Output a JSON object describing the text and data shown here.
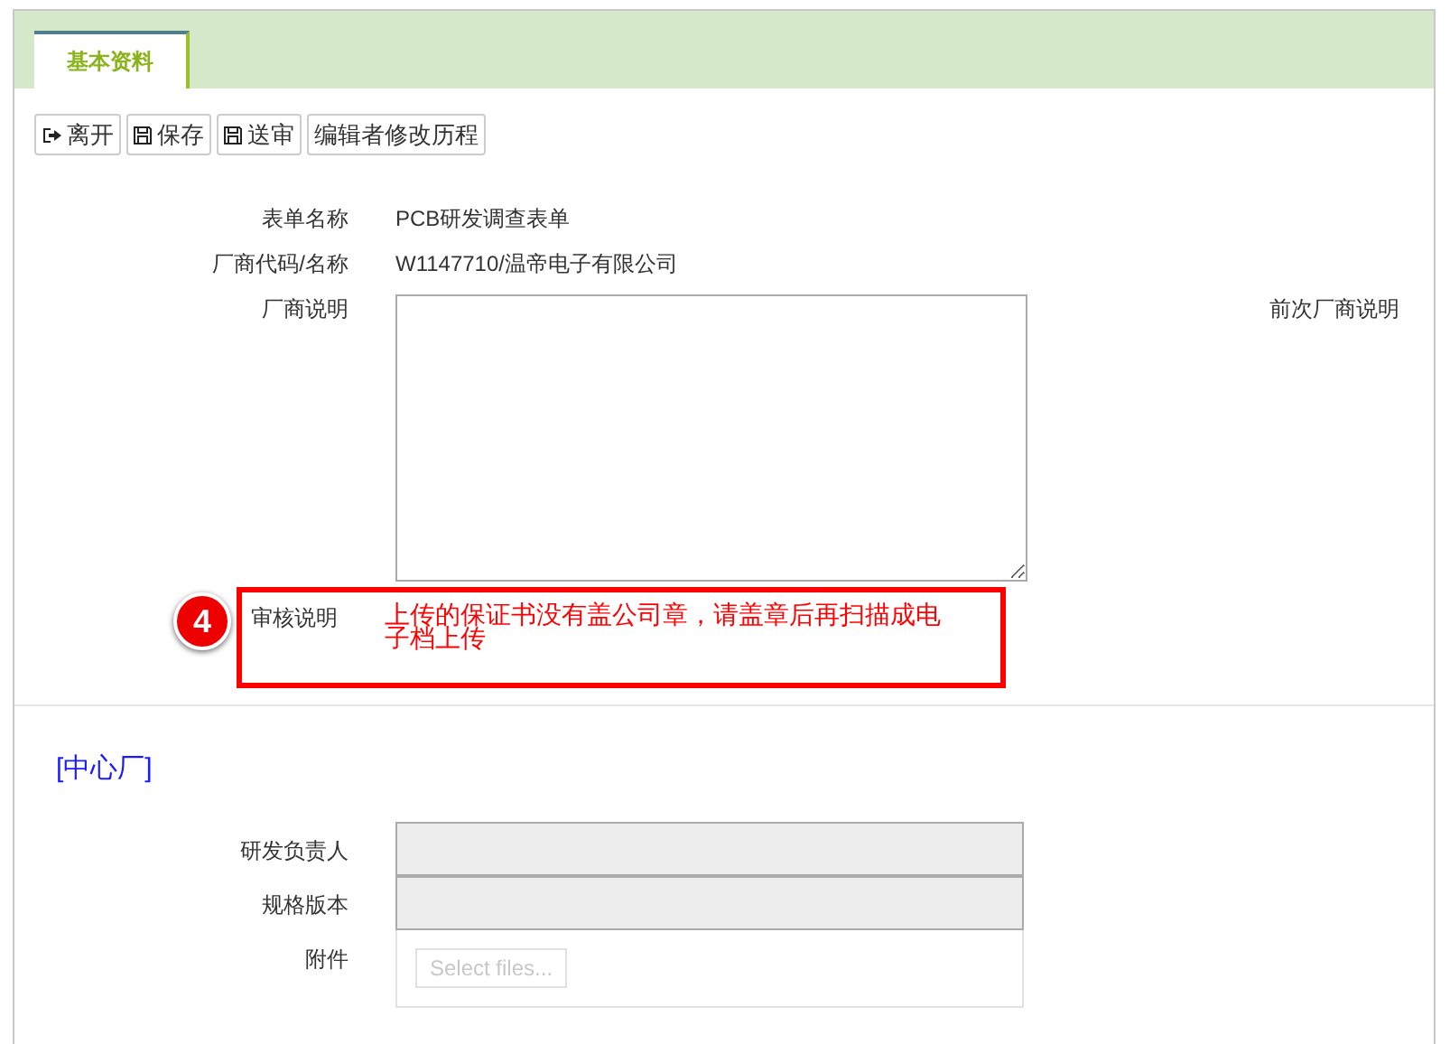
{
  "tabs": [
    {
      "label": "基本资料",
      "selected": true
    }
  ],
  "toolbar": [
    {
      "label": "离开",
      "kind": "exit"
    },
    {
      "label": "保存",
      "kind": "save"
    },
    {
      "label": "送审",
      "kind": "save"
    },
    {
      "label": "编辑者修改历程",
      "kind": "plain"
    }
  ],
  "form": {
    "form_name": {
      "label": "表单名称",
      "value": "PCB研发调查表单"
    },
    "vendor": {
      "label": "厂商代码/名称",
      "value": "W1147710/温帝电子有限公司"
    },
    "vendor_note": {
      "label": "厂商说明"
    },
    "previous_vendor_note": {
      "label": "前次厂商说明"
    },
    "review": {
      "badge": "4",
      "label": "审核说明",
      "value": "上传的保证书没有盖公司章，请盖章后再扫描成电子档上传"
    }
  },
  "section": {
    "title": "[中心厂]",
    "fields": [
      {
        "kind": "input",
        "label": "研发负责人",
        "disabled": true
      },
      {
        "kind": "input",
        "label": "规格版本",
        "disabled": true
      },
      {
        "kind": "upload",
        "label": "附件",
        "button": "Select files...",
        "disabled": true
      }
    ]
  }
}
